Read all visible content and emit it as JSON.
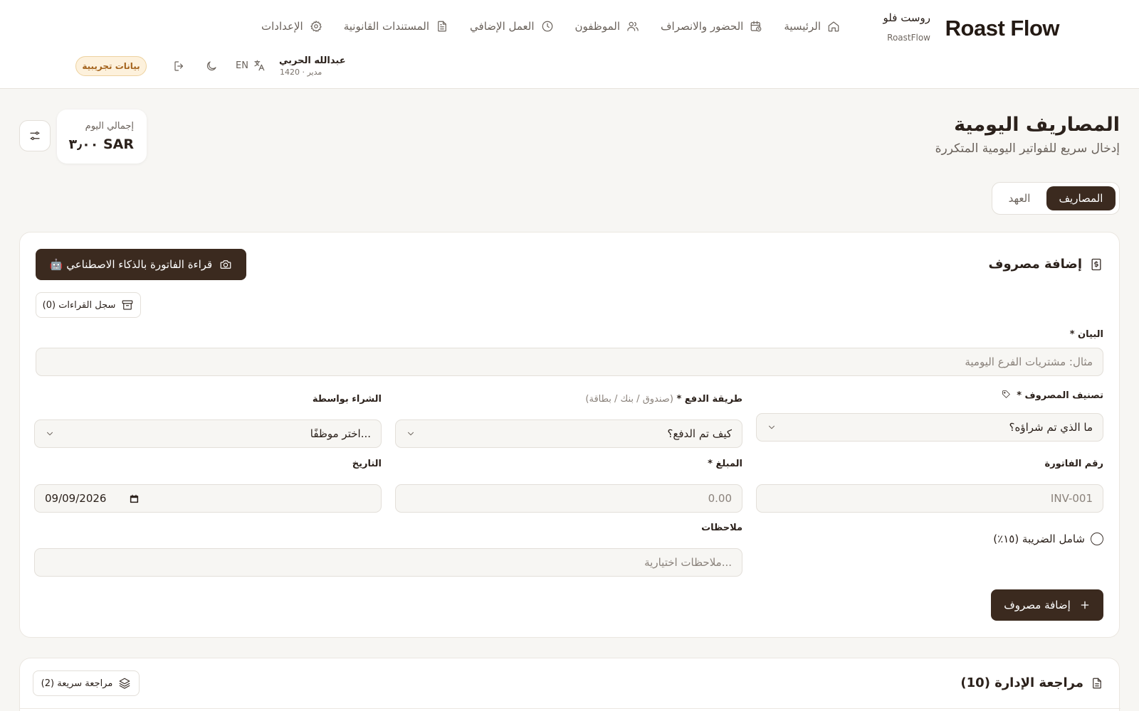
{
  "header": {
    "logo": "Roast Flow",
    "brand_ar": "روست فلو",
    "brand_en": "RoastFlow",
    "nav": [
      {
        "label": "الرئيسية",
        "icon": "home-icon"
      },
      {
        "label": "الحضور والانصراف",
        "icon": "calendar-clock-icon"
      },
      {
        "label": "الموظفون",
        "icon": "users-icon"
      },
      {
        "label": "العمل الإضافي",
        "icon": "clock-icon"
      },
      {
        "label": "المستندات القانونية",
        "icon": "document-icon"
      },
      {
        "label": "الإعدادات",
        "icon": "gear-icon"
      }
    ],
    "user": {
      "name": "عبدالله الحربي",
      "role": "مدير · 1420"
    },
    "language": "EN",
    "demo_badge": "بيانات تجريبية"
  },
  "page": {
    "title": "المصاريف اليومية",
    "subtitle": "إدخال سريع للفواتير اليومية المتكررة",
    "total_label": "إجمالي اليوم",
    "total_value": "٣٫٠٠ SAR",
    "tabs": [
      {
        "label": "المصاريف",
        "active": true
      },
      {
        "label": "العهد",
        "active": false
      }
    ]
  },
  "form": {
    "title": "إضافة مصروف",
    "ai_button": "🤖 قراءة الفاتورة بالذكاء الاصطناعي",
    "log_button": "سجل القراءات (0)",
    "description": {
      "label": "البيان *",
      "placeholder": "مثال: مشتريات الفرع اليومية"
    },
    "category": {
      "label": "تصنيف المصروف *",
      "value": "ما الذي تم شراؤه؟"
    },
    "payment": {
      "label": "طريقة الدفع *",
      "hint": "(صندوق / بنك / بطاقة)",
      "value": "كيف تم الدفع؟"
    },
    "purchased_by": {
      "label": "الشراء بواسطة",
      "value": "اختر موظفًا..."
    },
    "invoice": {
      "label": "رقم الفاتورة",
      "placeholder": "INV-001"
    },
    "amount": {
      "label": "المبلغ *",
      "placeholder": "0.00"
    },
    "date": {
      "label": "التاريخ",
      "value": "09/09/2026"
    },
    "tax": {
      "label": "شامل الضريبة (١٥٪)",
      "checked": false
    },
    "notes": {
      "label": "ملاحظات",
      "placeholder": "ملاحظات اختيارية..."
    },
    "add_button": "إضافة مصروف"
  },
  "review": {
    "title": "مراجعة الإدارة (10)",
    "quick_button": "مراجعة سريعة (2)"
  }
}
